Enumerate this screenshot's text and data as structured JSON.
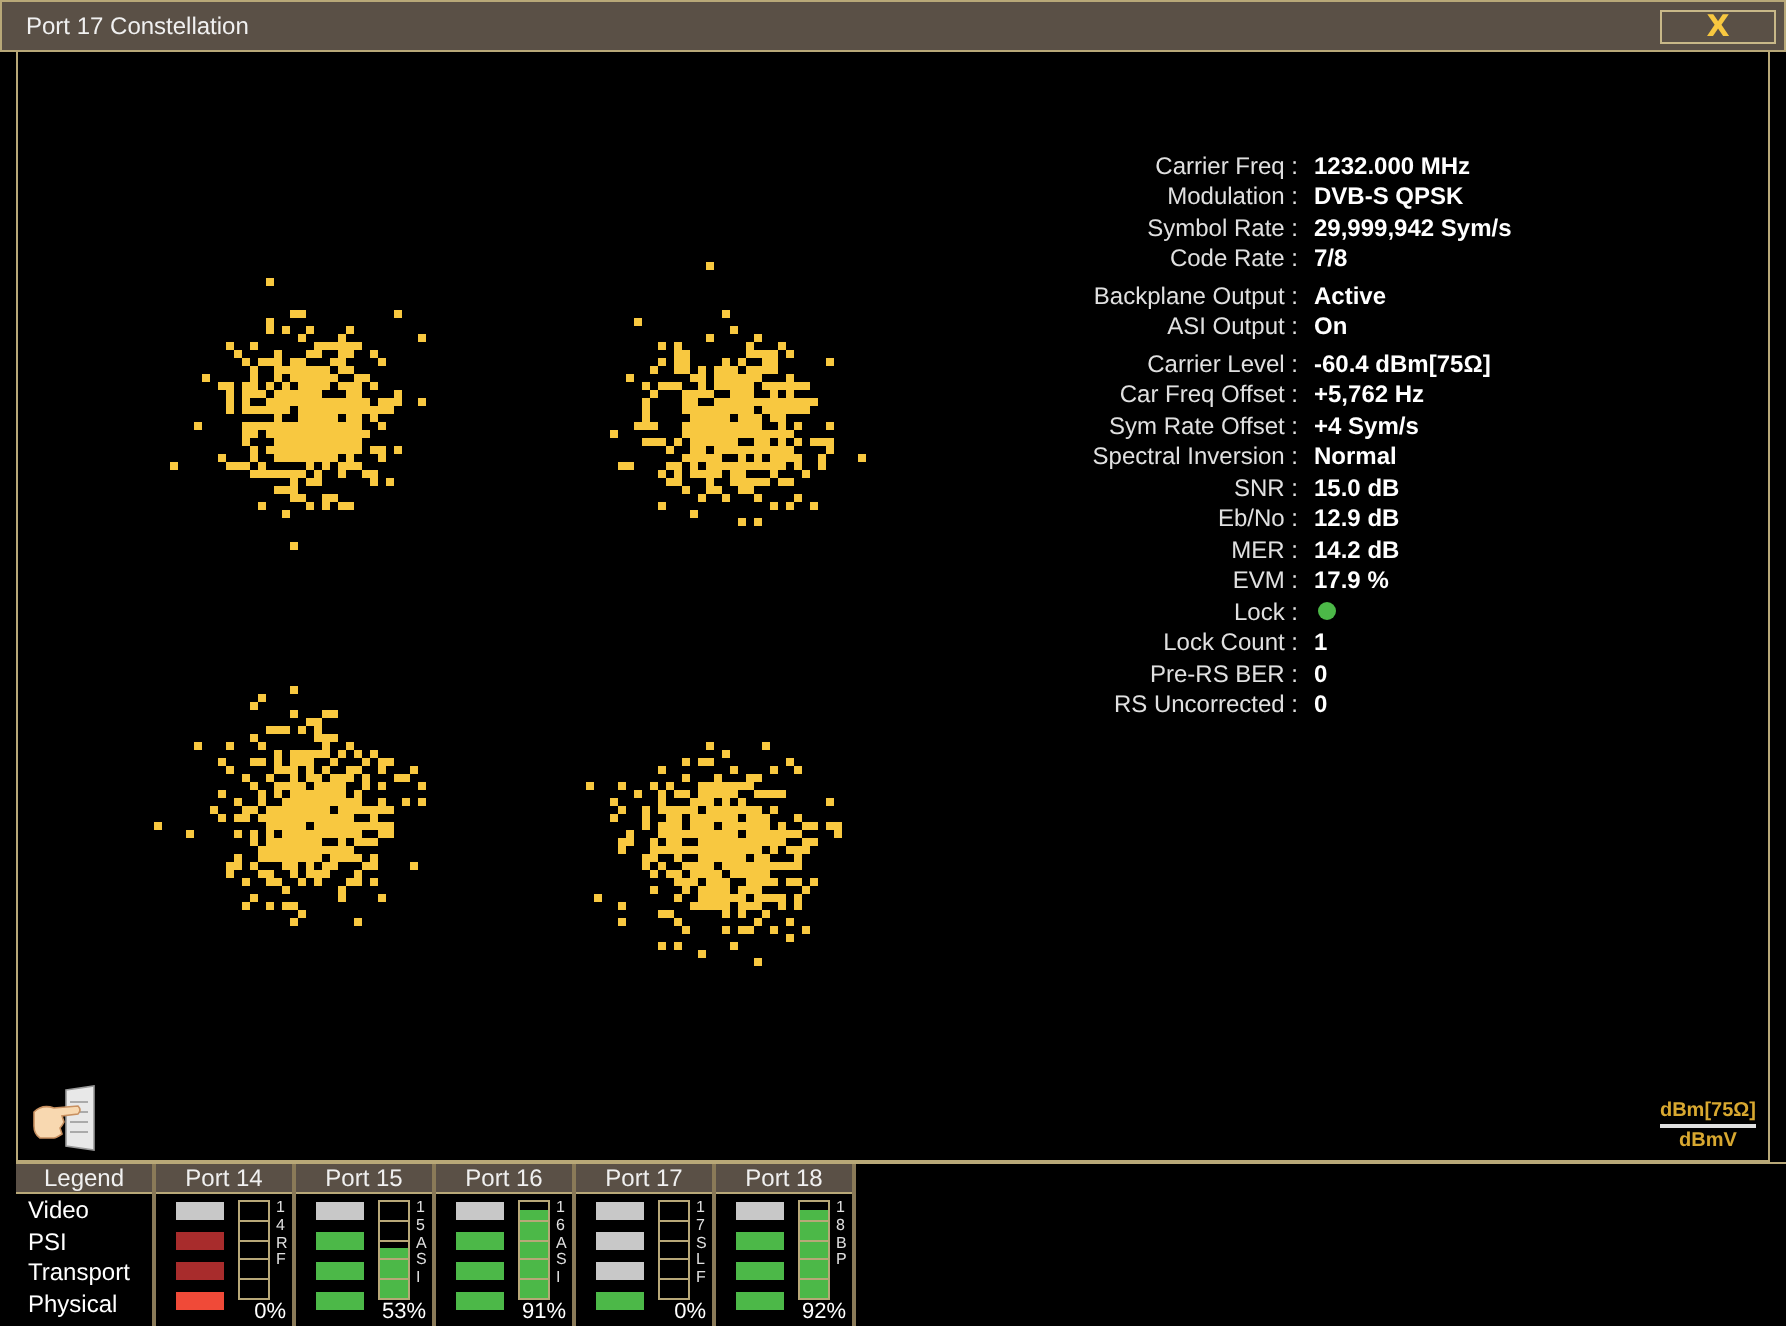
{
  "window": {
    "title": "Port 17 Constellation",
    "close_label": "X"
  },
  "stat_groups": [
    [
      {
        "label": "Carrier Freq :",
        "value": "1232.000 MHz",
        "kind": "text"
      },
      {
        "label": "Modulation :",
        "value": "DVB-S QPSK",
        "kind": "text"
      },
      {
        "label": "Symbol Rate :",
        "value": "29,999,942 Sym/s",
        "kind": "text"
      },
      {
        "label": "Code Rate :",
        "value": "7/8",
        "kind": "text"
      }
    ],
    [
      {
        "label": "Backplane Output :",
        "value": "Active",
        "kind": "text"
      },
      {
        "label": "ASI Output :",
        "value": "On",
        "kind": "text"
      }
    ],
    [
      {
        "label": "Carrier Level :",
        "value": "-60.4 dBm[75Ω]",
        "kind": "text"
      },
      {
        "label": "Car Freq Offset :",
        "value": "+5,762 Hz",
        "kind": "text"
      },
      {
        "label": "Sym Rate Offset :",
        "value": "+4 Sym/s",
        "kind": "text"
      },
      {
        "label": "Spectral Inversion :",
        "value": "Normal",
        "kind": "text"
      },
      {
        "label": "SNR :",
        "value": "15.0 dB",
        "kind": "text"
      },
      {
        "label": "Eb/No :",
        "value": "12.9 dB",
        "kind": "text"
      },
      {
        "label": "MER :",
        "value": "14.2 dB",
        "kind": "text"
      },
      {
        "label": "EVM :",
        "value": "17.9 %",
        "kind": "text"
      },
      {
        "label": "Lock :",
        "kind": "dot",
        "color": "#4cb848"
      },
      {
        "label": "Lock Count :",
        "value": "1",
        "kind": "text"
      },
      {
        "label": "Pre-RS BER :",
        "value": "0",
        "kind": "text"
      },
      {
        "label": "RS Uncorrected :",
        "value": "0",
        "kind": "text"
      }
    ]
  ],
  "units": [
    {
      "label": "dBm[75Ω]",
      "selected": true
    },
    {
      "label": "dBmV",
      "selected": false
    }
  ],
  "legend": {
    "title": "Legend",
    "rows": [
      "Video",
      "PSI",
      "Transport",
      "Physical"
    ]
  },
  "ports": [
    {
      "name": "Port 14",
      "tag": "14RF",
      "percent": "0%",
      "status": [
        {
          "color": "#c8c8c8"
        },
        {
          "color": "#a82c2c"
        },
        {
          "color": "#a82c2c"
        },
        {
          "color": "#f04a38"
        }
      ]
    },
    {
      "name": "Port 15",
      "tag": "15ASI",
      "percent": "53%",
      "level": 0.53,
      "status": [
        {
          "color": "#c8c8c8"
        },
        {
          "color": "#4cb848"
        },
        {
          "color": "#4cb848"
        },
        {
          "color": "#4cb848"
        }
      ]
    },
    {
      "name": "Port 16",
      "tag": "16ASI",
      "percent": "91%",
      "level": 0.91,
      "status": [
        {
          "color": "#c8c8c8"
        },
        {
          "color": "#4cb848"
        },
        {
          "color": "#4cb848"
        },
        {
          "color": "#4cb848"
        }
      ]
    },
    {
      "name": "Port 17",
      "tag": "17SLF",
      "percent": "0%",
      "status": [
        {
          "color": "#c8c8c8"
        },
        {
          "color": "#c8c8c8"
        },
        {
          "color": "#c8c8c8"
        },
        {
          "color": "#4cb848"
        }
      ]
    },
    {
      "name": "Port 18",
      "tag": "18BP",
      "percent": "92%",
      "level": 0.92,
      "status": [
        {
          "color": "#c8c8c8"
        },
        {
          "color": "#4cb848"
        },
        {
          "color": "#4cb848"
        },
        {
          "color": "#4cb848"
        }
      ]
    }
  ]
}
